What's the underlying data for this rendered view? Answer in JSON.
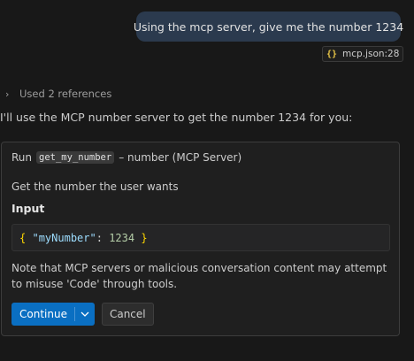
{
  "user_message": "Using the mcp server, give me the number 1234",
  "reference_chip": {
    "icon": "json-braces-icon",
    "braces": "{}",
    "label": "mcp.json:28"
  },
  "references": {
    "label": "Used 2 references"
  },
  "assistant": {
    "text": "I'll use the MCP number server to get the number 1234 for you:"
  },
  "tool_call": {
    "run_prefix": "Run",
    "tool_name": "get_my_number",
    "run_suffix": "– number (MCP Server)",
    "description": "Get the number the user wants",
    "input_heading": "Input",
    "input_json": {
      "open": "{",
      "key": "\"myNumber\"",
      "colon": ":",
      "value": "1234",
      "close": "}"
    },
    "note": "Note that MCP servers or malicious conversation content may attempt to misuse 'Code' through tools.",
    "continue_label": "Continue",
    "cancel_label": "Cancel"
  },
  "colors": {
    "user_bubble": "#2b3a4e",
    "primary_button": "#0a6fc2",
    "json_brace": "#ffd700",
    "json_key": "#9cdcfe",
    "json_number": "#b5cea8"
  }
}
